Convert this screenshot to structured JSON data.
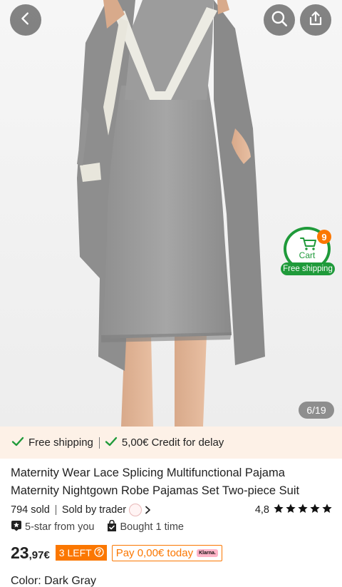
{
  "gallery": {
    "counter": "6/19"
  },
  "cart_widget": {
    "label": "Cart",
    "count": "9",
    "shipping_label": "Free shipping"
  },
  "benefits": {
    "free_shipping": "Free shipping",
    "delay_credit": "5,00€ Credit for delay"
  },
  "product": {
    "title": "Maternity Wear Lace Splicing Multifunctional Pajama Maternity Nightgown Robe Pajamas Set Two-piece Suit",
    "sold": "794 sold",
    "sold_by": "Sold by trader",
    "rating": "4,8",
    "rating_stars": 5,
    "tag_five_star": "5-star from you",
    "tag_bought": "Bought 1 time",
    "price_int": "23",
    "price_dec": ",97€",
    "stock_label": "3 LEFT",
    "klarna_text": "Pay 0,00€ today",
    "klarna_logo": "Klarna.",
    "color": "Color: Dark Gray"
  },
  "icons": {
    "back": "chevron-left-icon",
    "search": "search-icon",
    "share": "share-icon",
    "cart": "cart-icon",
    "check": "check-icon",
    "star": "star-icon"
  },
  "colors": {
    "accent_orange": "#fb7701",
    "green": "#1f9a3a",
    "benefit_bg": "#fdf1e7"
  }
}
